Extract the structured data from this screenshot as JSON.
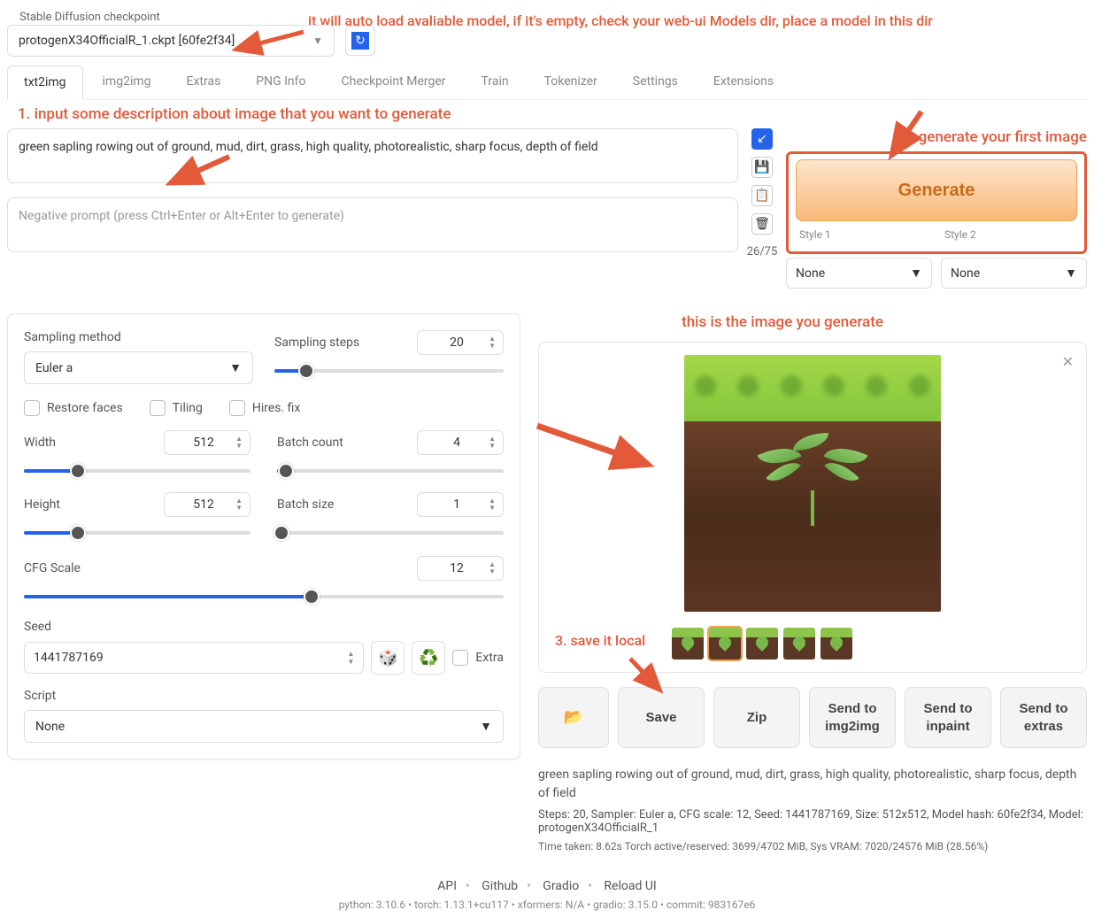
{
  "checkpoint": {
    "label": "Stable Diffusion checkpoint",
    "value": "protogenX34OfficialR_1.ckpt [60fe2f34]"
  },
  "annotations": {
    "top": "it will auto load avaliable model, if it's empty, check your web-ui Models dir, place a model in this dir",
    "step1": "1. input some description about image that you want to generate",
    "step2": "2. generate your first image",
    "mid": "this is the image you generate",
    "step3": "3. save it local"
  },
  "tabs": [
    "txt2img",
    "img2img",
    "Extras",
    "PNG Info",
    "Checkpoint Merger",
    "Train",
    "Tokenizer",
    "Settings",
    "Extensions"
  ],
  "prompt": "green sapling rowing out of ground, mud, dirt, grass, high quality, photorealistic, sharp focus, depth of field",
  "neg_placeholder": "Negative prompt (press Ctrl+Enter or Alt+Enter to generate)",
  "token_count": "26/75",
  "generate_label": "Generate",
  "styles": {
    "label1": "Style 1",
    "label2": "Style 2",
    "value1": "None",
    "value2": "None"
  },
  "sampling": {
    "method_label": "Sampling method",
    "method_value": "Euler a",
    "steps_label": "Sampling steps",
    "steps_value": "20"
  },
  "checks": {
    "restore": "Restore faces",
    "tiling": "Tiling",
    "hires": "Hires. fix"
  },
  "dims": {
    "width_label": "Width",
    "width_value": "512",
    "height_label": "Height",
    "height_value": "512"
  },
  "batch": {
    "count_label": "Batch count",
    "count_value": "4",
    "size_label": "Batch size",
    "size_value": "1"
  },
  "cfg": {
    "label": "CFG Scale",
    "value": "12"
  },
  "seed": {
    "label": "Seed",
    "value": "1441787169",
    "extra": "Extra"
  },
  "script": {
    "label": "Script",
    "value": "None"
  },
  "actions": {
    "save": "Save",
    "zip": "Zip",
    "img2img": "Send to img2img",
    "inpaint": "Send to inpaint",
    "extras": "Send to extras"
  },
  "result": {
    "prompt": "green sapling rowing out of ground, mud, dirt, grass, high quality, photorealistic, sharp focus, depth of field",
    "meta": "Steps: 20, Sampler: Euler a, CFG scale: 12, Seed: 1441787169, Size: 512x512, Model hash: 60fe2f34, Model: protogenX34OfficialR_1",
    "time": "Time taken: 8.62s  Torch active/reserved: 3699/4702 MiB, Sys VRAM: 7020/24576 MiB (28.56%)"
  },
  "footer": {
    "links": [
      "API",
      "Github",
      "Gradio",
      "Reload UI"
    ],
    "info": "python: 3.10.6   •   torch: 1.13.1+cu117   •   xformers: N/A   •   gradio: 3.15.0   •   commit: 983167e6"
  }
}
